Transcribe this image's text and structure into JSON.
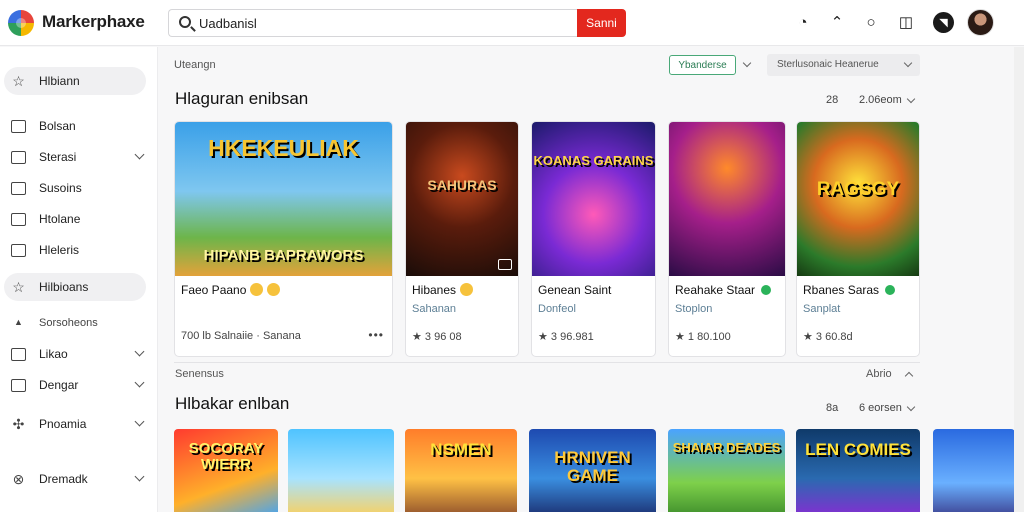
{
  "app": {
    "brand": "Markerphaxe"
  },
  "search": {
    "value": "Uadbanisl",
    "button_label": "Sanni"
  },
  "sidebar": {
    "items": [
      {
        "label": "Hlbiann"
      },
      {
        "label": "Bolsan"
      },
      {
        "label": "Sterasi"
      },
      {
        "label": "Susoins"
      },
      {
        "label": "Htolane"
      },
      {
        "label": "Hleleris"
      },
      {
        "label": "Hilbioans"
      },
      {
        "label": "Sorsoheons"
      },
      {
        "label": "Likao"
      },
      {
        "label": "Dengar"
      },
      {
        "label": "Pnoamia"
      },
      {
        "label": "Dremadk"
      }
    ]
  },
  "toolbar": {
    "breadcrumb": "Uteangn",
    "filter_label": "Ybanderse",
    "sort_label": "Sterlusonaic Heanerue"
  },
  "section1": {
    "title": "Hlaguran enibsan",
    "count": "28",
    "sort": "2.06eom",
    "cards": [
      {
        "thumb_text": "HKEKEULIAK",
        "thumb_text2": "HIPANB BAPRAWORS",
        "title": "Faeo Paano",
        "stat": "700 lb Salnaiie · Sanana"
      },
      {
        "thumb_text": "SAHURAS",
        "title": "Hibanes",
        "subtitle": "Sahanan",
        "stat": "★ 3 96 08"
      },
      {
        "thumb_text": "KOANAS GARAINS",
        "title": "Genean Saint",
        "subtitle": "Donfeol",
        "stat": "★ 3 96.981"
      },
      {
        "thumb_text": "",
        "title": "Reahake Staar",
        "subtitle": "Stoplon",
        "stat": "★ 1 80.100"
      },
      {
        "thumb_text": "RAGSGY",
        "title": "Rbanes Saras",
        "subtitle": "Sanplat",
        "stat": "★ 3 60.8d"
      }
    ]
  },
  "section_divider": {
    "label": "Senensus",
    "toggle": "Abrio"
  },
  "section2": {
    "title": "Hlbakar enlban",
    "count": "8a",
    "sort": "6 eorsen",
    "cards": [
      {
        "thumb_text": "SOCORAY WIERR"
      },
      {
        "thumb_text": ""
      },
      {
        "thumb_text": "NSMEN"
      },
      {
        "thumb_text": "HRNIVEN GAME"
      },
      {
        "thumb_text": "SHAIAR DEADES"
      },
      {
        "thumb_text": "LEN COMIES"
      },
      {
        "thumb_text": ""
      }
    ]
  },
  "colors": {
    "accent": "#e3281e",
    "green": "#49a878"
  }
}
